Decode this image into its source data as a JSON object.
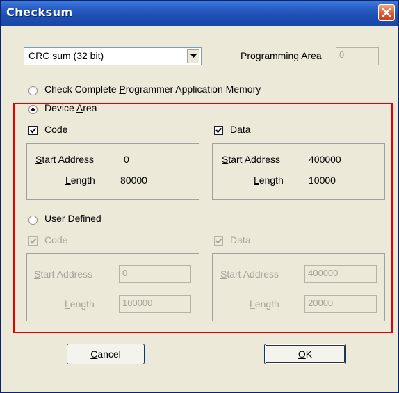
{
  "window": {
    "title": "Checksum"
  },
  "checksum_type": {
    "selected": "CRC sum (32 bit)"
  },
  "programming_area": {
    "label": "Programming Area",
    "value": "0"
  },
  "options": {
    "check_complete_label": "Check Complete Programmer Application Memory",
    "device_area_label": "Device Area",
    "user_defined_label": "User Defined"
  },
  "device_area": {
    "code": {
      "label": "Code",
      "start_label": "Start Address",
      "start_value": "0",
      "length_label": "Length",
      "length_value": "80000"
    },
    "data": {
      "label": "Data",
      "start_label": "Start Address",
      "start_value": "400000",
      "length_label": "Length",
      "length_value": "10000"
    }
  },
  "user_defined": {
    "code": {
      "label": "Code",
      "start_label": "Start Address",
      "start_value": "0",
      "length_label": "Length",
      "length_value": "100000"
    },
    "data": {
      "label": "Data",
      "start_label": "Start Address",
      "start_value": "400000",
      "length_label": "Length",
      "length_value": "20000"
    }
  },
  "buttons": {
    "cancel": "Cancel",
    "ok": "OK"
  },
  "colors": {
    "title_bar": "#1d4fb3",
    "highlight_box": "#e20000",
    "dialog_bg": "#ece9d8",
    "disabled_text": "#a6a49a"
  }
}
